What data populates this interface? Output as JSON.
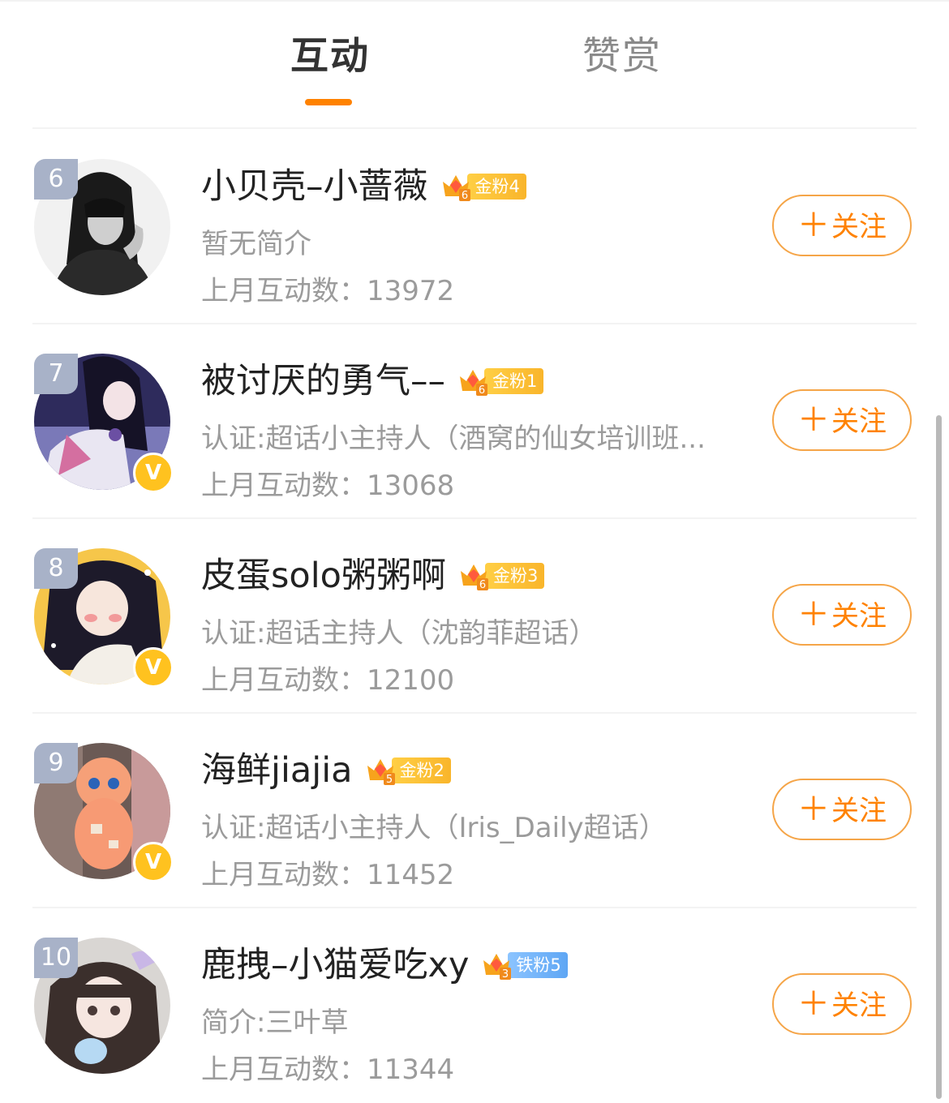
{
  "tabs": [
    {
      "label": "互动",
      "active": true
    },
    {
      "label": "赞赏",
      "active": false
    }
  ],
  "colors": {
    "accent": "#ff8200",
    "rank_bg": "#a8b2c8",
    "verified": "#ffc21f",
    "gold_fan": "#f9b52b",
    "iron_fan": "#5ea6f4"
  },
  "follow_label": "关注",
  "users": [
    {
      "rank": "6",
      "name": "小贝壳–小蔷薇",
      "crown_level": "6",
      "fan_label": "金粉4",
      "fan_type": "gold",
      "desc": "暂无简介",
      "count": "上月互动数：13972",
      "verified": false
    },
    {
      "rank": "7",
      "name": "被讨厌的勇气––",
      "crown_level": "6",
      "fan_label": "金粉1",
      "fan_type": "gold",
      "desc": "认证:超话小主持人（酒窝的仙女培训班...",
      "count": "上月互动数：13068",
      "verified": true
    },
    {
      "rank": "8",
      "name": "皮蛋solo粥粥啊",
      "crown_level": "6",
      "fan_label": "金粉3",
      "fan_type": "gold",
      "desc": "认证:超话主持人（沈韵菲超话）",
      "count": "上月互动数：12100",
      "verified": true
    },
    {
      "rank": "9",
      "name": "海鲜jiajia",
      "crown_level": "5",
      "fan_label": "金粉2",
      "fan_type": "gold",
      "desc": "认证:超话小主持人（Iris_Daily超话）",
      "count": "上月互动数：11452",
      "verified": true
    },
    {
      "rank": "10",
      "name": "鹿拽–小猫爱吃xy",
      "crown_level": "3",
      "fan_label": "铁粉5",
      "fan_type": "iron",
      "desc": "简介:三叶草",
      "count": "上月互动数：11344",
      "verified": false
    }
  ]
}
